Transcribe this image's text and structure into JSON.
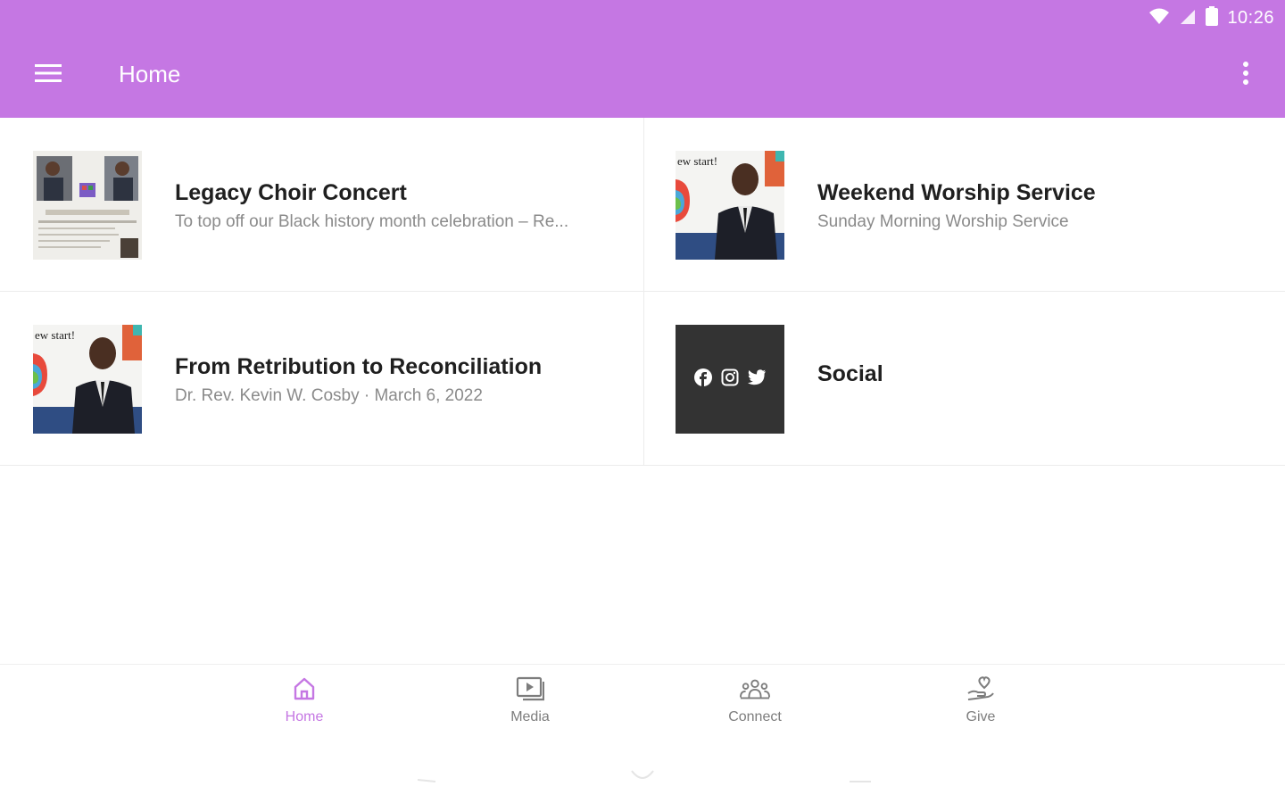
{
  "status_bar": {
    "time": "10:26"
  },
  "app_bar": {
    "title": "Home"
  },
  "colors": {
    "accent": "#c577e3",
    "text": "#1f1f1f",
    "muted": "#8a8a8a"
  },
  "cards": [
    {
      "title": "Legacy Choir Concert",
      "subtitle": "To top off our Black history month celebration – Re..."
    },
    {
      "title": "Weekend Worship Service",
      "subtitle": "Sunday Morning Worship Service"
    },
    {
      "title": "From Retribution to Reconciliation",
      "subtitle": "Dr. Rev. Kevin W. Cosby · March 6, 2022"
    },
    {
      "title": "Social",
      "subtitle": ""
    }
  ],
  "thumb_text": {
    "new_start": "ew start!"
  },
  "bottom_nav": [
    {
      "label": "Home",
      "icon": "home-icon",
      "active": true
    },
    {
      "label": "Media",
      "icon": "media-icon",
      "active": false
    },
    {
      "label": "Connect",
      "icon": "people-icon",
      "active": false
    },
    {
      "label": "Give",
      "icon": "give-hand-icon",
      "active": false
    }
  ]
}
